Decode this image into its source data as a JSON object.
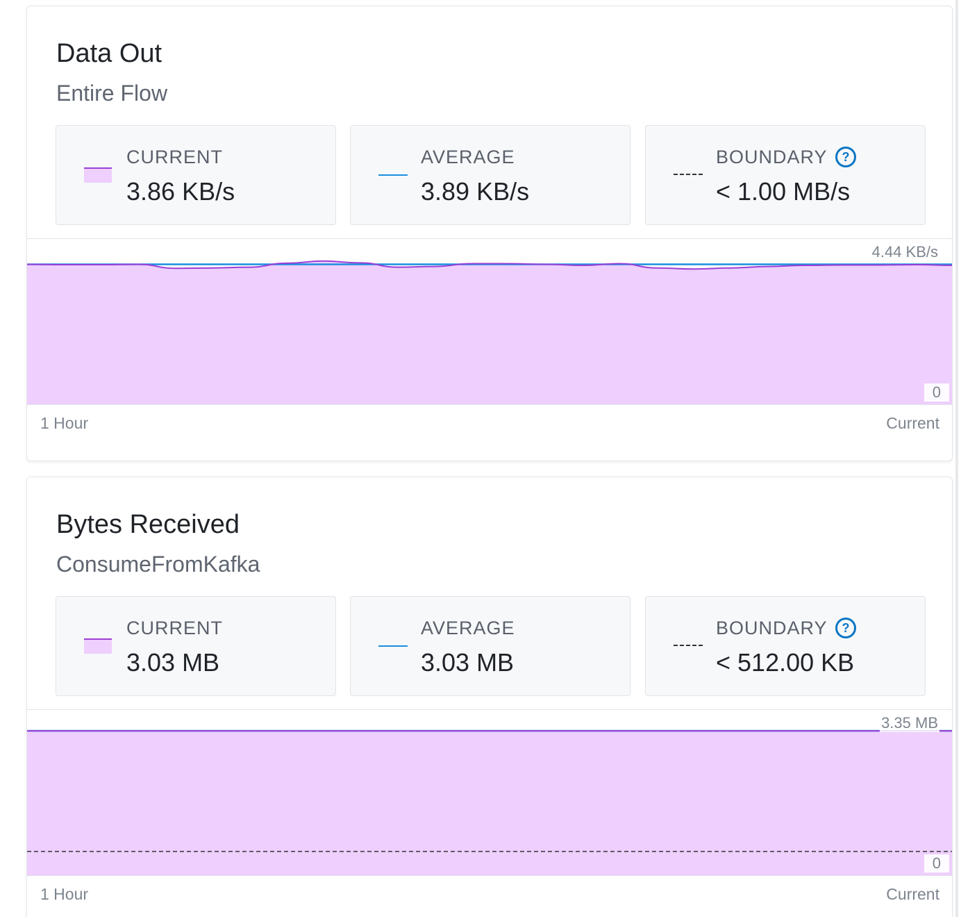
{
  "cards": [
    {
      "title": "Data Out",
      "subtitle": "Entire Flow",
      "current_label": "CURRENT",
      "current_value": "3.86 KB/s",
      "average_label": "AVERAGE",
      "average_value": "3.89 KB/s",
      "boundary_label": "BOUNDARY",
      "boundary_value": "< 1.00 MB/s",
      "help_icon": "question-circle-icon",
      "axis_max_label": "4.44 KB/s",
      "axis_zero_label": "0",
      "time_start_label": "1 Hour",
      "time_end_label": "Current"
    },
    {
      "title": "Bytes Received",
      "subtitle": "ConsumeFromKafka",
      "current_label": "CURRENT",
      "current_value": "3.03 MB",
      "average_label": "AVERAGE",
      "average_value": "3.03 MB",
      "boundary_label": "BOUNDARY",
      "boundary_value": "< 512.00 KB",
      "help_icon": "question-circle-icon",
      "axis_max_label": "3.35 MB",
      "axis_zero_label": "0",
      "time_start_label": "1 Hour",
      "time_end_label": "Current"
    }
  ],
  "colors": {
    "current_line": "#9b3fd6",
    "current_fill": "#eecffd",
    "average_line": "#1a8fdd",
    "boundary_line": "#333333",
    "help_icon": "#0a76c4"
  },
  "chart_data": [
    {
      "type": "area",
      "xlabel": "",
      "ylabel": "",
      "x_range": [
        "1 Hour",
        "Current"
      ],
      "ylim": [
        0,
        4.44
      ],
      "y_unit": "KB/s",
      "grid": false,
      "series": [
        {
          "name": "CURRENT",
          "values": [
            3.89,
            3.88,
            3.88,
            3.89,
            3.78,
            3.79,
            3.81,
            3.92,
            3.98,
            3.93,
            3.81,
            3.83,
            3.91,
            3.91,
            3.89,
            3.86,
            3.91,
            3.79,
            3.76,
            3.79,
            3.83,
            3.86,
            3.87,
            3.87,
            3.88,
            3.86
          ]
        },
        {
          "name": "AVERAGE",
          "values": [
            3.89,
            3.89,
            3.89,
            3.89,
            3.89,
            3.89,
            3.89,
            3.89,
            3.89,
            3.89,
            3.89,
            3.89,
            3.89,
            3.89,
            3.89,
            3.89,
            3.89,
            3.89,
            3.89,
            3.89,
            3.89,
            3.89,
            3.89,
            3.89,
            3.89,
            3.89
          ]
        }
      ],
      "boundary": 1000
    },
    {
      "type": "area",
      "xlabel": "",
      "ylabel": "",
      "x_range": [
        "1 Hour",
        "Current"
      ],
      "ylim": [
        0,
        3.35
      ],
      "y_unit": "MB",
      "grid": false,
      "series": [
        {
          "name": "CURRENT",
          "values": [
            3.03,
            3.03,
            3.03,
            3.03,
            3.03,
            3.03,
            3.03,
            3.03,
            3.03,
            3.03,
            3.03,
            3.03,
            3.03,
            3.03,
            3.03,
            3.03,
            3.03,
            3.03,
            3.03,
            3.03,
            3.03,
            3.03,
            3.03,
            3.03,
            3.03,
            3.03
          ]
        },
        {
          "name": "AVERAGE",
          "values": [
            3.03,
            3.03,
            3.03,
            3.03,
            3.03,
            3.03,
            3.03,
            3.03,
            3.03,
            3.03,
            3.03,
            3.03,
            3.03,
            3.03,
            3.03,
            3.03,
            3.03,
            3.03,
            3.03,
            3.03,
            3.03,
            3.03,
            3.03,
            3.03,
            3.03,
            3.03
          ]
        }
      ],
      "boundary": 0.5
    }
  ]
}
